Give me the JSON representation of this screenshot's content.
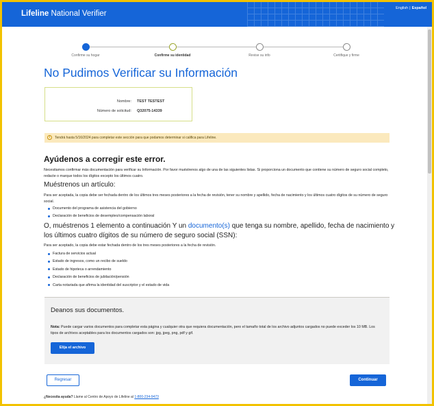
{
  "header": {
    "logo_bold": "Lifeline",
    "logo_rest": " National Verifier",
    "lang_english": "English",
    "lang_sep": "|",
    "lang_spanish": "Español"
  },
  "stepper": {
    "steps": [
      {
        "label": "Confirme su hogar",
        "state": "done"
      },
      {
        "label": "Confirme su identidad",
        "state": "current"
      },
      {
        "label": "Revise su info",
        "state": "pending"
      },
      {
        "label": "Certifique y firme",
        "state": "pending"
      }
    ]
  },
  "page_title": "No Pudimos Verificar su Información",
  "info": {
    "name_label": "Nombre:",
    "name_value": "TEST TESTEST",
    "app_label": "Número de solicitud:",
    "app_value": "Q32075-14339"
  },
  "alert_text": "Tendrá hasta 5/16/2024 para completar este sección para que podamos determinar si califica para Lifeline.",
  "help": {
    "heading": "Ayúdenos a corregir este error.",
    "intro": "Necesitamos confirmar más documentación para verificar su Información. Por favor muéstrenos algo de una de las siguientes listas. Si proporciona un documento que contiene su número de seguro social completo, redacte o marque todos los dígitos excepto los últimos cuatro.",
    "show_one_heading": "Muéstrenos un artículo:",
    "show_one_req": "Para ser aceptada, la copia debe ser fechada dentro de los últimos tres meses posteriores a la fecha de revisión, tener su nombre y apellido, fecha de nacimiento y los últimos cuatro dígitos de su número de seguro social.",
    "list_one": [
      "Documento del programa de asistencia del gobierno",
      "Declaración de beneficios de desempleo/compensación laboral"
    ],
    "show_two_pre": "O, muéstrenos 1 elemento a continuación Y un ",
    "show_two_link": "documento(s)",
    "show_two_post": " que tenga su nombre, apellido, fecha de nacimiento y los últimos cuatro dígitos de su número de seguro social (SSN):",
    "show_two_req": "Para ser aceptado, la copia debe estar fechada dentro de los tres meses posteriores a la fecha de revisión.",
    "list_two": [
      "Factura de servicios actual",
      "Estado de ingresos, como un recibo de sueldo",
      "Estado de hipoteca o arrendamiento",
      "Declaración de beneficios de jubilación/pensión",
      "Carta notariada que afirma la identidad del suscriptor y el estado de vida"
    ]
  },
  "upload": {
    "heading": "Deanos sus documentos.",
    "note_label": "Nota:",
    "note_text": " Puede cargar varios documentos para completar esta página y cualquier otra que requiera documentación, pero el tamaño total de los archivo adjuntos cargados no puede exceder los 10 MB. Los tipos de archivos aceptables para los documentos cargados son: jpg, jpeg, png, pdf y gif.",
    "choose_label": "Elija el archivo"
  },
  "nav": {
    "back_label": "Regresar",
    "next_label": "Continuar"
  },
  "footer": {
    "need_help": "¿Necesita ayuda?",
    "text": " Llame al Centro de Apoyo de Lifeline al ",
    "phone": "1-800-234-9473"
  },
  "colors": {
    "brand": "#1565d8",
    "frame": "#f2c200",
    "alert_bg": "#fbe9bd"
  }
}
